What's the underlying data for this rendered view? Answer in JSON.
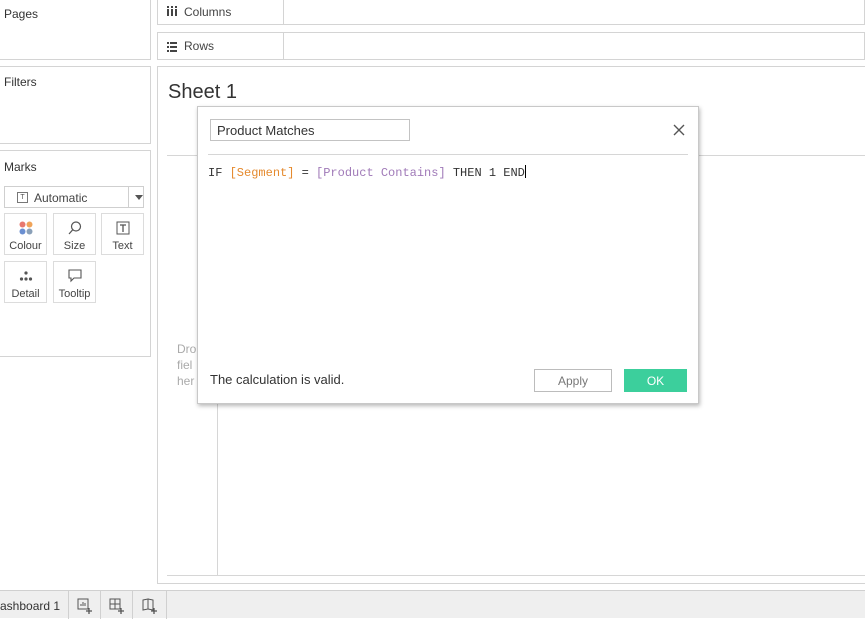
{
  "panels": {
    "pages": "Pages",
    "filters": "Filters",
    "marks": "Marks"
  },
  "marks": {
    "type": "Automatic",
    "buttons": [
      {
        "label": "Colour",
        "icon": "colour-dots-icon"
      },
      {
        "label": "Size",
        "icon": "size-lasso-icon"
      },
      {
        "label": "Text",
        "icon": "text-box-icon"
      },
      {
        "label": "Detail",
        "icon": "detail-dots-icon"
      },
      {
        "label": "Tooltip",
        "icon": "tooltip-bubble-icon"
      }
    ]
  },
  "shelves": {
    "columns": "Columns",
    "rows": "Rows"
  },
  "sheet": {
    "title": "Sheet 1",
    "drop_hint_lines": [
      "Dro",
      "fiel",
      "her"
    ]
  },
  "dialog": {
    "calc_name": "Product Matches",
    "formula": {
      "if": "IF",
      "field1": "[Segment]",
      "eq": "=",
      "field2": "[Product Contains]",
      "then": "THEN 1 END"
    },
    "status": "The calculation is valid.",
    "apply_label": "Apply",
    "ok_label": "OK"
  },
  "tabs": {
    "dashboard": "ashboard 1"
  },
  "colors": {
    "ok_button": "#3ccf9c",
    "field_orange": "#e58a2e",
    "field_purple": "#a07ab8"
  }
}
